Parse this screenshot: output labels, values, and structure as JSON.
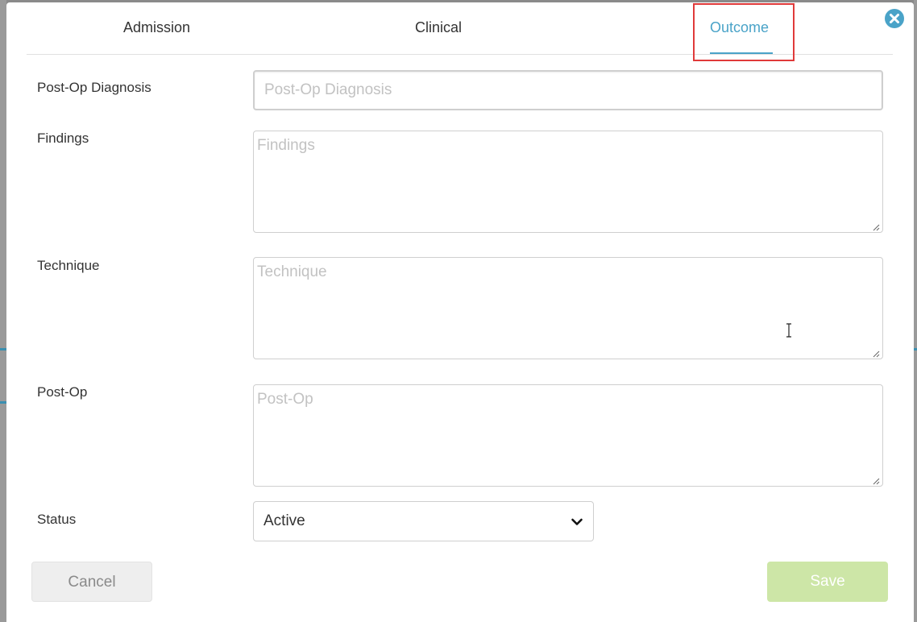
{
  "tabs": [
    {
      "label": "Admission",
      "active": false
    },
    {
      "label": "Clinical",
      "active": false
    },
    {
      "label": "Outcome",
      "active": true
    }
  ],
  "colors": {
    "accent": "#4aa3c8",
    "highlight": "#e03a3a",
    "save_disabled": "#cde6a7"
  },
  "close_icon": "close-circle-icon",
  "form": {
    "post_op_diagnosis": {
      "label": "Post-Op Diagnosis",
      "placeholder": "Post-Op Diagnosis",
      "value": ""
    },
    "findings": {
      "label": "Findings",
      "placeholder": "Findings",
      "value": ""
    },
    "technique": {
      "label": "Technique",
      "placeholder": "Technique",
      "value": ""
    },
    "post_op": {
      "label": "Post-Op",
      "placeholder": "Post-Op",
      "value": ""
    },
    "status": {
      "label": "Status",
      "value": "Active"
    }
  },
  "buttons": {
    "cancel": "Cancel",
    "save": "Save"
  }
}
